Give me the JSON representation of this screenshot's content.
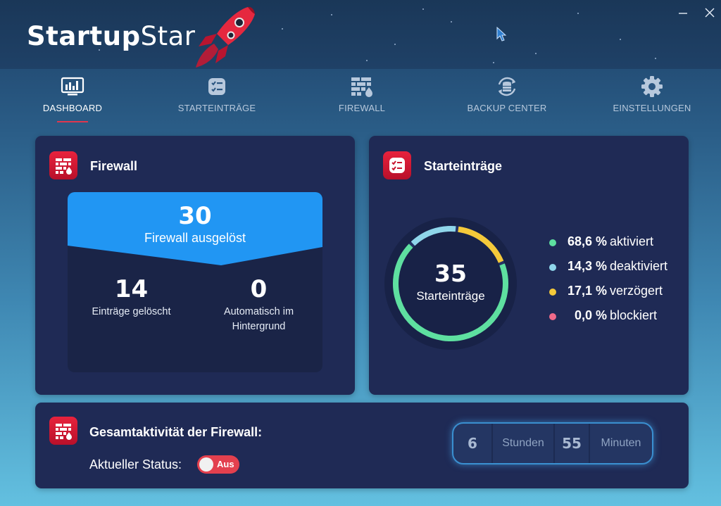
{
  "app": {
    "title_bold": "Startup",
    "title_light": "Star",
    "window": {
      "minimize_icon": "minimize-icon",
      "close_icon": "close-icon"
    }
  },
  "nav": {
    "items": [
      {
        "label": "DASHBOARD",
        "icon": "dashboard-icon",
        "active": true
      },
      {
        "label": "STARTEINTRÄGE",
        "icon": "startup-list-icon",
        "active": false
      },
      {
        "label": "FIREWALL",
        "icon": "firewall-icon",
        "active": false
      },
      {
        "label": "BACKUP CENTER",
        "icon": "backup-icon",
        "active": false
      },
      {
        "label": "EINSTELLUNGEN",
        "icon": "gear-icon",
        "active": false
      }
    ]
  },
  "firewall_card": {
    "title": "Firewall",
    "triggered_count": "30",
    "triggered_label": "Firewall ausgelöst",
    "deleted_count": "14",
    "deleted_label": "Einträge gelöscht",
    "auto_count": "0",
    "auto_label_line1": "Automatisch im",
    "auto_label_line2": "Hintergrund"
  },
  "startup_card": {
    "title": "Starteinträge",
    "total": "35",
    "total_label": "Starteinträge",
    "legend": [
      {
        "value": "68,6 %",
        "label": "aktiviert",
        "color": "#5ee0a0",
        "fraction": 0.686
      },
      {
        "value": "14,3 %",
        "label": "deaktiviert",
        "color": "#8fd6ea",
        "fraction": 0.143
      },
      {
        "value": "17,1 %",
        "label": "verzögert",
        "color": "#f4c93a",
        "fraction": 0.171
      },
      {
        "value": "0,0 %",
        "label": "blockiert",
        "color": "#f06a8a",
        "fraction": 0.0
      }
    ]
  },
  "activity_card": {
    "title": "Gesamtaktivität der Firewall:",
    "status_label": "Aktueller Status:",
    "toggle_label": "Aus",
    "hours_value": "6",
    "hours_unit": "Stunden",
    "minutes_value": "55",
    "minutes_unit": "Minuten"
  },
  "colors": {
    "accent_red": "#e0364e",
    "card_bg": "#1f2a55",
    "firewall_blue": "#2196f3",
    "timer_border": "#3a8fd0"
  }
}
